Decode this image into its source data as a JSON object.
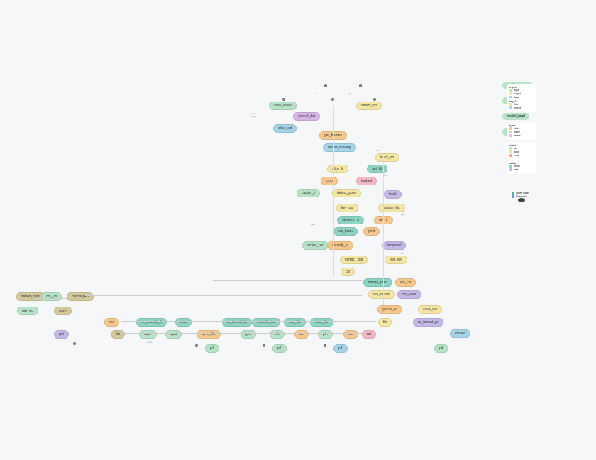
{
  "nodes": {
    "n1": "slice_video",
    "n2": "yolov8_det",
    "n3": "slice_vid",
    "n4": "detect_ob",
    "n5": "get_frames",
    "n6": "detect_moving",
    "n7": "track_obj",
    "n8": "slice_fr",
    "n9": "get_bb",
    "n10": "crop",
    "n11": "embed",
    "n12": "cluster_t",
    "n13": "detect_pose",
    "n14": "track",
    "n15": "key_pts",
    "n16": "assign_ids",
    "n17": "skeleton_tr",
    "n18": "get_tr",
    "n19": "vis_track",
    "n20": "joint",
    "n21": "action_rec",
    "n22": "classify_st",
    "n23": "temporal",
    "n24": "extract_clip",
    "n25": "feat_ext",
    "n26": "cls",
    "n27": "merge_pred",
    "n28": "vid_cls",
    "n29": "run_model",
    "n30": "out_save",
    "n31": "group_ac",
    "n32": "save_res",
    "n33": "embed",
    "n34": "saved_path",
    "n35": "col_vis",
    "n36": "concat_vid",
    "n37": "get_vid",
    "n38": "save",
    "n39": "ren",
    "n40": "re_encode_fr",
    "n41": "mux",
    "n42": "re_format_ts",
    "n43": "encode_out",
    "n44": "enc_file",
    "n45": "mux_file",
    "n46": "re_format_pc",
    "n47": "get",
    "n48": "file",
    "n49": "save",
    "n50": "upld",
    "n51": "save_file",
    "n52": "gen",
    "n53": "pth",
    "n54": "up",
    "n55": "pth",
    "n56": "out",
    "n57": "ret"
  },
  "legend": {
    "l1": "start_process",
    "l2": "data_source",
    "l3": "model_load",
    "l4": "func_exec"
  },
  "keybox": {
    "k1": {
      "title": "legend",
      "a": "input",
      "b": "output",
      "c": "data"
    },
    "k2": {
      "title": "key_2",
      "a": "flow",
      "b": "branch"
    },
    "k3": {
      "title": "types",
      "a": "video",
      "b": "frame",
      "c": "tensor"
    },
    "k4": {
      "title": "states",
      "a": "run",
      "b": "done",
      "c": "error"
    },
    "k5": {
      "title": "status",
      "a": "ready",
      "b": "wait"
    }
  },
  "colorkey": {
    "a": "green node",
    "b": "blue node"
  }
}
